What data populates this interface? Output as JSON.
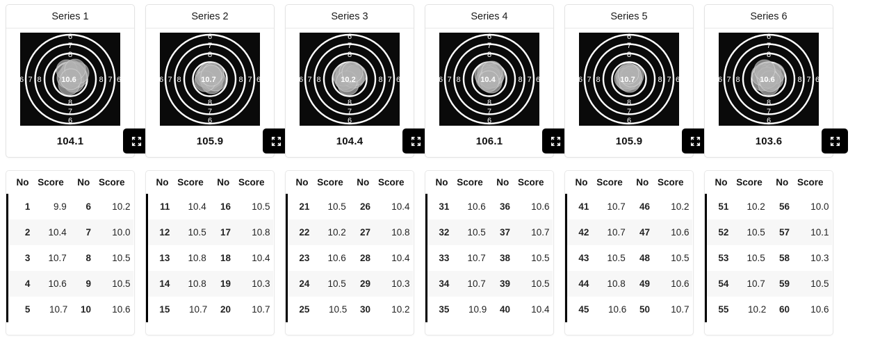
{
  "table_headers": [
    "No",
    "Score",
    "No",
    "Score"
  ],
  "expand_icon": "expand-arrows-icon",
  "colors": {
    "target_background": "#0a0a0a",
    "ring_line": "#ffffff",
    "shot_fill": "#b0b0b0",
    "accent_bar": "#000000",
    "button_bg": "#000000",
    "row_stripe": "#f7f7f7"
  },
  "series": [
    {
      "title": "Series 1",
      "total": "104.1",
      "target": {
        "center_label": "10.6",
        "ring_labels": [
          "6",
          "7",
          "8"
        ],
        "shots": [
          {
            "x": 0.0,
            "y": 8.0,
            "r": 15.0
          },
          {
            "x": -4.0,
            "y": 2.0,
            "r": 15.0
          },
          {
            "x": 5.0,
            "y": -4.0,
            "r": 15.0
          },
          {
            "x": 10.0,
            "y": 3.0,
            "r": 15.0
          },
          {
            "x": -2.0,
            "y": -8.0,
            "r": 15.0
          },
          {
            "x": 3.0,
            "y": 12.0,
            "r": 15.0
          },
          {
            "x": 12.0,
            "y": 9.0,
            "r": 15.0
          },
          {
            "x": -5.0,
            "y": 13.0,
            "r": 15.0
          },
          {
            "x": 7.0,
            "y": 14.0,
            "r": 15.0
          },
          {
            "x": 1.0,
            "y": 0.0,
            "r": 15.0
          }
        ]
      },
      "rows": [
        {
          "no": "1",
          "score": "9.9",
          "no2": "6",
          "score2": "10.2"
        },
        {
          "no": "2",
          "score": "10.4",
          "no2": "7",
          "score2": "10.0"
        },
        {
          "no": "3",
          "score": "10.7",
          "no2": "8",
          "score2": "10.5"
        },
        {
          "no": "4",
          "score": "10.6",
          "no2": "9",
          "score2": "10.5"
        },
        {
          "no": "5",
          "score": "10.7",
          "no2": "10",
          "score2": "10.6"
        }
      ]
    },
    {
      "title": "Series 2",
      "total": "105.9",
      "target": {
        "center_label": "10.7",
        "ring_labels": [
          "6",
          "7",
          "8"
        ],
        "shots": [
          {
            "x": 0.0,
            "y": 0.0,
            "r": 15.0
          },
          {
            "x": 6.0,
            "y": 4.0,
            "r": 15.0
          },
          {
            "x": -6.0,
            "y": 3.0,
            "r": 15.0
          },
          {
            "x": 3.0,
            "y": -6.0,
            "r": 15.0
          },
          {
            "x": -3.0,
            "y": 7.0,
            "r": 15.0
          },
          {
            "x": 8.0,
            "y": -2.0,
            "r": 15.0
          },
          {
            "x": -1.0,
            "y": 9.0,
            "r": 15.0
          },
          {
            "x": 5.0,
            "y": 9.0,
            "r": 15.0
          },
          {
            "x": -7.0,
            "y": -3.0,
            "r": 15.0
          },
          {
            "x": 2.0,
            "y": 5.0,
            "r": 15.0
          }
        ]
      },
      "rows": [
        {
          "no": "11",
          "score": "10.4",
          "no2": "16",
          "score2": "10.5"
        },
        {
          "no": "12",
          "score": "10.5",
          "no2": "17",
          "score2": "10.8"
        },
        {
          "no": "13",
          "score": "10.8",
          "no2": "18",
          "score2": "10.4"
        },
        {
          "no": "14",
          "score": "10.8",
          "no2": "19",
          "score2": "10.3"
        },
        {
          "no": "15",
          "score": "10.7",
          "no2": "20",
          "score2": "10.7"
        }
      ]
    },
    {
      "title": "Series 3",
      "total": "104.4",
      "target": {
        "center_label": "10.2",
        "ring_labels": [
          "6",
          "7",
          "8"
        ],
        "shots": [
          {
            "x": -2.0,
            "y": -8.0,
            "r": 15.0
          },
          {
            "x": -7.0,
            "y": 0.0,
            "r": 15.0
          },
          {
            "x": 2.0,
            "y": 4.0,
            "r": 15.0
          },
          {
            "x": -5.0,
            "y": 8.0,
            "r": 15.0
          },
          {
            "x": 6.0,
            "y": 2.0,
            "r": 15.0
          },
          {
            "x": -9.0,
            "y": 5.0,
            "r": 15.0
          },
          {
            "x": 0.0,
            "y": 10.0,
            "r": 15.0
          },
          {
            "x": 9.0,
            "y": 6.0,
            "r": 15.0
          },
          {
            "x": -4.0,
            "y": -3.0,
            "r": 15.0
          },
          {
            "x": 4.0,
            "y": 10.0,
            "r": 15.0
          }
        ]
      },
      "rows": [
        {
          "no": "21",
          "score": "10.5",
          "no2": "26",
          "score2": "10.4"
        },
        {
          "no": "22",
          "score": "10.2",
          "no2": "27",
          "score2": "10.8"
        },
        {
          "no": "23",
          "score": "10.6",
          "no2": "28",
          "score2": "10.4"
        },
        {
          "no": "24",
          "score": "10.5",
          "no2": "29",
          "score2": "10.3"
        },
        {
          "no": "25",
          "score": "10.5",
          "no2": "30",
          "score2": "10.2"
        }
      ]
    },
    {
      "title": "Series 4",
      "total": "106.1",
      "target": {
        "center_label": "10.4",
        "ring_labels": [
          "6",
          "7",
          "8"
        ],
        "shots": [
          {
            "x": -4.0,
            "y": 0.0,
            "r": 15.0
          },
          {
            "x": 5.0,
            "y": 2.0,
            "r": 15.0
          },
          {
            "x": 0.0,
            "y": 7.0,
            "r": 15.0
          },
          {
            "x": 3.0,
            "y": -5.0,
            "r": 15.0
          },
          {
            "x": -2.0,
            "y": 10.0,
            "r": 15.0
          },
          {
            "x": 7.0,
            "y": 7.0,
            "r": 15.0
          },
          {
            "x": -6.0,
            "y": 6.0,
            "r": 15.0
          },
          {
            "x": 1.0,
            "y": 2.0,
            "r": 15.0
          },
          {
            "x": 4.0,
            "y": 11.0,
            "r": 15.0
          },
          {
            "x": -1.0,
            "y": -3.0,
            "r": 15.0
          }
        ]
      },
      "rows": [
        {
          "no": "31",
          "score": "10.6",
          "no2": "36",
          "score2": "10.6"
        },
        {
          "no": "32",
          "score": "10.5",
          "no2": "37",
          "score2": "10.7"
        },
        {
          "no": "33",
          "score": "10.7",
          "no2": "38",
          "score2": "10.5"
        },
        {
          "no": "34",
          "score": "10.7",
          "no2": "39",
          "score2": "10.5"
        },
        {
          "no": "35",
          "score": "10.9",
          "no2": "40",
          "score2": "10.4"
        }
      ]
    },
    {
      "title": "Series 5",
      "total": "105.9",
      "target": {
        "center_label": "10.7",
        "ring_labels": [
          "6",
          "7",
          "8"
        ],
        "shots": [
          {
            "x": 0.0,
            "y": 2.0,
            "r": 15.0
          },
          {
            "x": -4.0,
            "y": 5.0,
            "r": 15.0
          },
          {
            "x": 4.0,
            "y": 0.0,
            "r": 15.0
          },
          {
            "x": 2.0,
            "y": 7.0,
            "r": 15.0
          },
          {
            "x": -3.0,
            "y": -2.0,
            "r": 15.0
          },
          {
            "x": 6.0,
            "y": 5.0,
            "r": 15.0
          },
          {
            "x": -6.0,
            "y": 1.0,
            "r": 15.0
          },
          {
            "x": 1.0,
            "y": -4.0,
            "r": 15.0
          },
          {
            "x": 3.0,
            "y": 4.0,
            "r": 15.0
          },
          {
            "x": -1.0,
            "y": 8.0,
            "r": 15.0
          }
        ]
      },
      "rows": [
        {
          "no": "41",
          "score": "10.7",
          "no2": "46",
          "score2": "10.2"
        },
        {
          "no": "42",
          "score": "10.7",
          "no2": "47",
          "score2": "10.6"
        },
        {
          "no": "43",
          "score": "10.5",
          "no2": "48",
          "score2": "10.5"
        },
        {
          "no": "44",
          "score": "10.8",
          "no2": "49",
          "score2": "10.6"
        },
        {
          "no": "45",
          "score": "10.6",
          "no2": "50",
          "score2": "10.7"
        }
      ]
    },
    {
      "title": "Series 6",
      "total": "103.6",
      "target": {
        "center_label": "10.6",
        "ring_labels": [
          "6",
          "7",
          "8"
        ],
        "shots": [
          {
            "x": -9.0,
            "y": -2.0,
            "r": 15.0
          },
          {
            "x": 0.0,
            "y": -8.0,
            "r": 15.0
          },
          {
            "x": 6.0,
            "y": 0.0,
            "r": 15.0
          },
          {
            "x": -4.0,
            "y": 8.0,
            "r": 15.0
          },
          {
            "x": 3.0,
            "y": 9.0,
            "r": 15.0
          },
          {
            "x": -10.0,
            "y": 6.0,
            "r": 15.0
          },
          {
            "x": 8.0,
            "y": 8.0,
            "r": 15.0
          },
          {
            "x": -2.0,
            "y": 2.0,
            "r": 15.0
          },
          {
            "x": 2.0,
            "y": -3.0,
            "r": 15.0
          },
          {
            "x": -6.0,
            "y": 13.0,
            "r": 15.0
          }
        ]
      },
      "rows": [
        {
          "no": "51",
          "score": "10.2",
          "no2": "56",
          "score2": "10.0"
        },
        {
          "no": "52",
          "score": "10.5",
          "no2": "57",
          "score2": "10.1"
        },
        {
          "no": "53",
          "score": "10.5",
          "no2": "58",
          "score2": "10.3"
        },
        {
          "no": "54",
          "score": "10.7",
          "no2": "59",
          "score2": "10.5"
        },
        {
          "no": "55",
          "score": "10.2",
          "no2": "60",
          "score2": "10.6"
        }
      ]
    }
  ]
}
